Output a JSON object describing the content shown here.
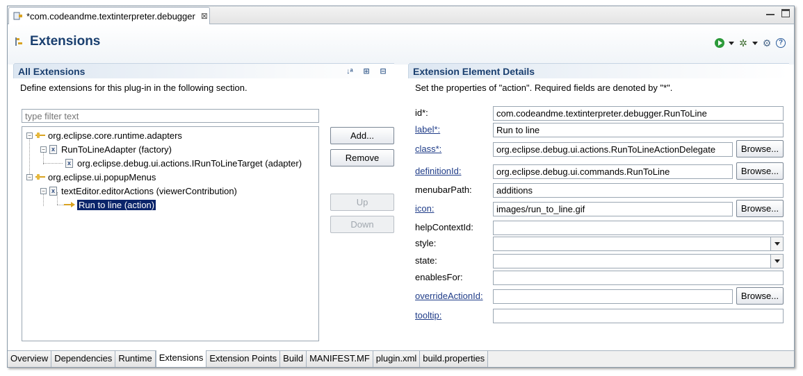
{
  "editor_tab": {
    "title": "*com.codeandme.textinterpreter.debugger",
    "close": "⊠"
  },
  "header": {
    "title": "Extensions"
  },
  "left": {
    "section_title": "All Extensions",
    "description": "Define extensions for this plug-in in the following section.",
    "filter_placeholder": "type filter text",
    "tree": [
      {
        "label": "org.eclipse.core.runtime.adapters",
        "level": 0
      },
      {
        "label": "RunToLineAdapter (factory)",
        "level": 1
      },
      {
        "label": "org.eclipse.debug.ui.actions.IRunToLineTarget (adapter)",
        "level": 2
      },
      {
        "label": "org.eclipse.ui.popupMenus",
        "level": 0
      },
      {
        "label": "textEditor.editorActions (viewerContribution)",
        "level": 1
      },
      {
        "label": "Run to line (action)",
        "level": 2,
        "selected": true
      }
    ],
    "buttons": {
      "add": "Add...",
      "remove": "Remove",
      "up": "Up",
      "down": "Down"
    }
  },
  "right": {
    "section_title": "Extension Element Details",
    "description": "Set the properties of \"action\". Required fields are denoted by \"*\".",
    "browse_label": "Browse...",
    "fields": [
      {
        "label": "id*:",
        "value": "com.codeandme.textinterpreter.debugger.RunToLine"
      },
      {
        "label": "label*:",
        "value": "Run to line"
      },
      {
        "label": "class*:",
        "value": "org.eclipse.debug.ui.actions.RunToLineActionDelegate"
      },
      {
        "label": "definitionId:",
        "value": "org.eclipse.debug.ui.commands.RunToLine"
      },
      {
        "label": "menubarPath:",
        "value": "additions"
      },
      {
        "label": "icon:",
        "value": "images/run_to_line.gif"
      },
      {
        "label": "helpContextId:",
        "value": ""
      },
      {
        "label": "style:",
        "value": ""
      },
      {
        "label": "state:",
        "value": ""
      },
      {
        "label": "enablesFor:",
        "value": ""
      },
      {
        "label": "overrideActionId:",
        "value": ""
      },
      {
        "label": "tooltip:",
        "value": ""
      }
    ]
  },
  "bottom_tabs": [
    "Overview",
    "Dependencies",
    "Runtime",
    "Extensions",
    "Extension Points",
    "Build",
    "MANIFEST.MF",
    "plugin.xml",
    "build.properties"
  ],
  "active_bottom_tab": "Extensions"
}
